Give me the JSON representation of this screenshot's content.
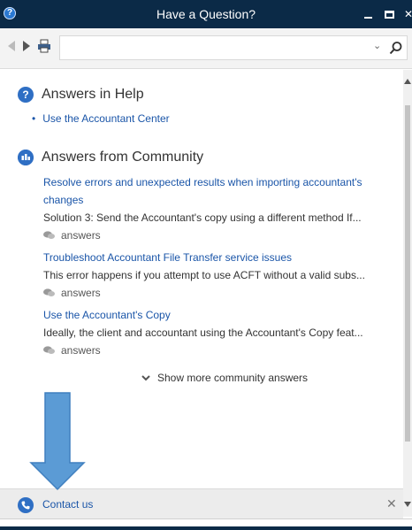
{
  "window": {
    "title": "Have a Question?",
    "app_icon": "question-circle-icon"
  },
  "toolbar": {
    "back_icon": "back-arrow-icon",
    "forward_icon": "forward-arrow-icon",
    "print_icon": "printer-icon",
    "search_value": "",
    "search_placeholder": "",
    "search_icon": "magnifier-icon"
  },
  "help_section": {
    "title": "Answers in Help",
    "items": [
      {
        "label": "Use the Accountant Center"
      }
    ]
  },
  "community_section": {
    "title": "Answers from Community",
    "items": [
      {
        "title": "Resolve errors and unexpected results when importing accountant's changes",
        "snippet": "Solution 3: Send the Accountant's copy using a different method If...",
        "meta": "answers"
      },
      {
        "title": "Troubleshoot Accountant File Transfer service issues",
        "snippet": "This error happens if you attempt to use ACFT without a valid subs...",
        "meta": "answers"
      },
      {
        "title": "Use the Accountant's Copy",
        "snippet": "Ideally, the client and accountant using the Accountant's Copy feat...",
        "meta": "answers"
      }
    ],
    "show_more": "Show more community answers"
  },
  "contact": {
    "label": "Contact us"
  },
  "colors": {
    "titlebar": "#0b2a47",
    "link": "#1a55a8",
    "section_icon": "#2f6fc4",
    "arrow": "#5b9bd5"
  }
}
